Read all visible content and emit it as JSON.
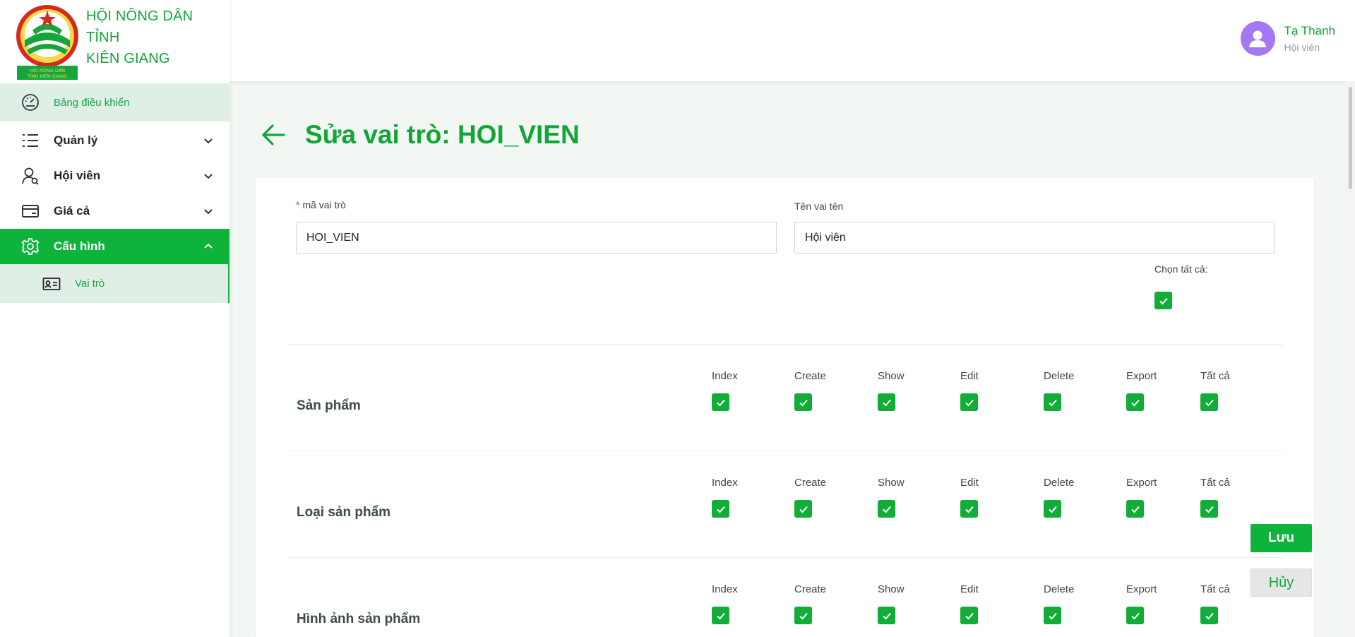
{
  "brand": {
    "line1": "HỘI NÔNG DÂN TỈNH",
    "line2": "KIÊN GIANG",
    "logo_text": "HỘI NÔNG DÂN TỈNH KIÊN GIANG"
  },
  "sidebar": {
    "dashboard": "Bảng điều khiển",
    "items": [
      {
        "label": "Quản lý",
        "icon": "list-icon"
      },
      {
        "label": "Hội viên",
        "icon": "user-icon"
      },
      {
        "label": "Giá cả",
        "icon": "card-icon"
      },
      {
        "label": "Cấu hình",
        "icon": "gear-icon"
      }
    ],
    "sub_item": "Vai trò"
  },
  "user": {
    "name": "Tạ Thanh",
    "role": "Hội viên"
  },
  "page": {
    "title": "Sửa vai trò: HOI_VIEN"
  },
  "form": {
    "code_label": "mã vai trò",
    "code_value": "HOI_VIEN",
    "name_label": "Tên vai tên",
    "name_value": "Hội viên",
    "select_all_label": "Chọn tất cả:"
  },
  "permission_columns": [
    "Index",
    "Create",
    "Show",
    "Edit",
    "Delete",
    "Export",
    "Tất cả"
  ],
  "permissions": [
    {
      "name": "Sản phẩm"
    },
    {
      "name": "Loại sản phẩm"
    },
    {
      "name": "Hình ảnh sản phẩm"
    }
  ],
  "buttons": {
    "save": "Lưu",
    "cancel": "Hủy"
  },
  "colors": {
    "primary": "#0db33b",
    "active_bg": "#e0efe5",
    "avatar": "#a378f2"
  }
}
